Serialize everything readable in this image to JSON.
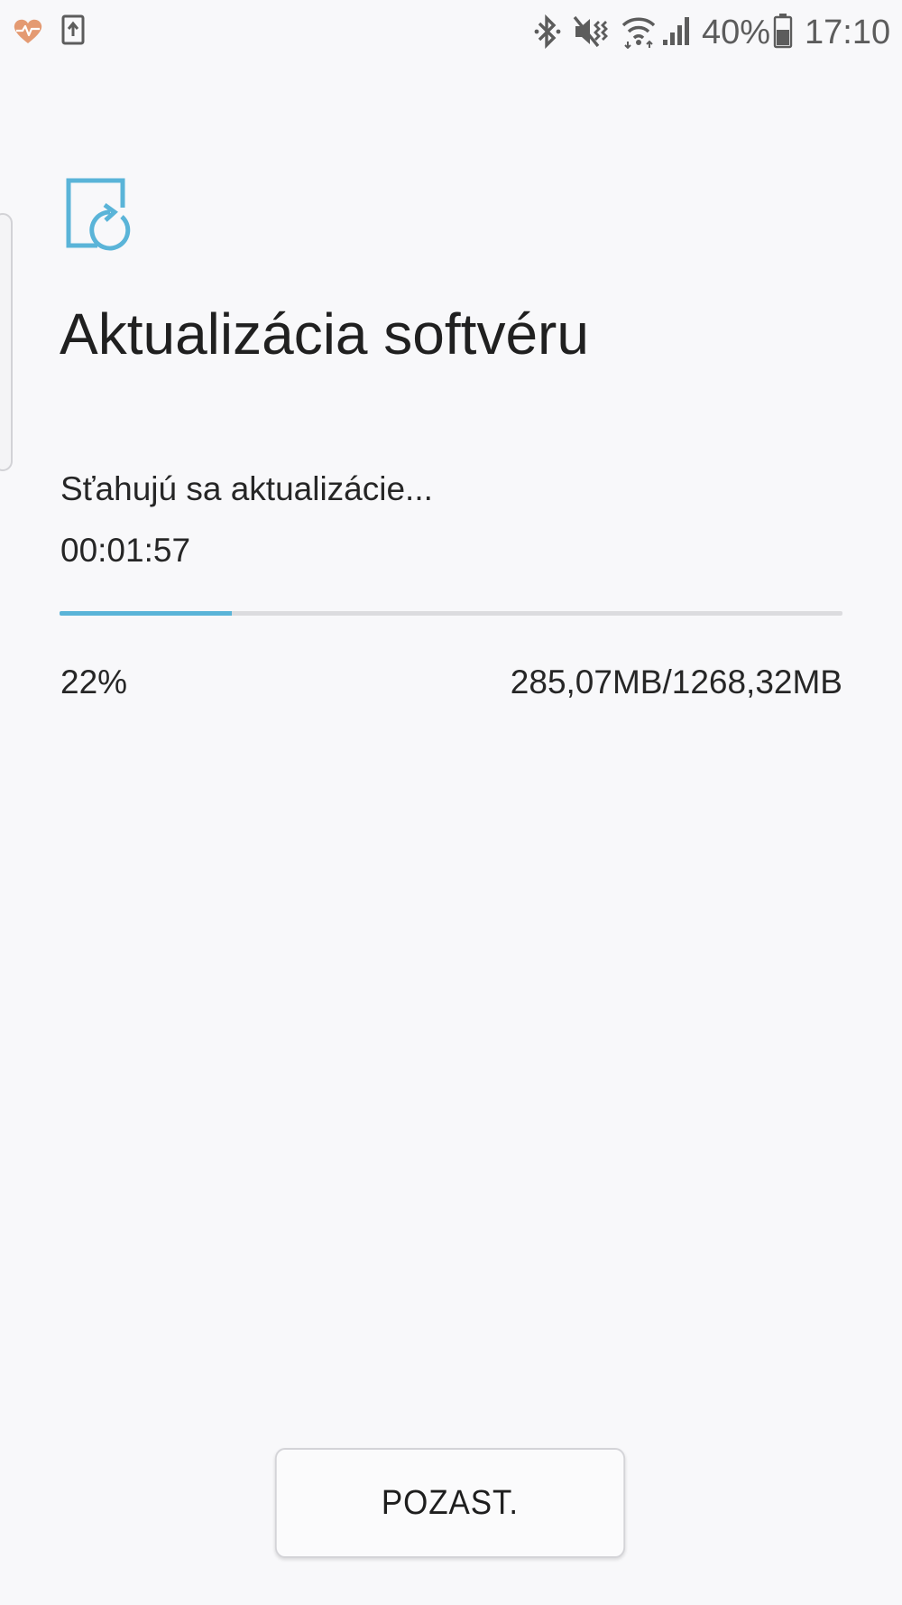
{
  "status_bar": {
    "left_icons": [
      "health-heart-icon",
      "device-update-icon"
    ],
    "right_icons": [
      "bluetooth-icon",
      "mute-vibrate-icon",
      "wifi-icon",
      "signal-icon",
      "battery-icon"
    ],
    "battery_level": "40%",
    "time": "17:10",
    "colors": {
      "heart": "#e49a72",
      "icons": "#5c5c5c"
    }
  },
  "header": {
    "icon": "software-update-icon",
    "icon_color": "#5ab4d8",
    "title": "Aktualizácia softvéru"
  },
  "download": {
    "status": "Sťahujú sa aktualizácie...",
    "elapsed": "00:01:57",
    "progress": 0.22,
    "percent_label": "22%",
    "size_label": "285,07MB/1268,32MB",
    "progress_color": "#5ab4d8"
  },
  "actions": {
    "pause_label": "POZAST."
  }
}
